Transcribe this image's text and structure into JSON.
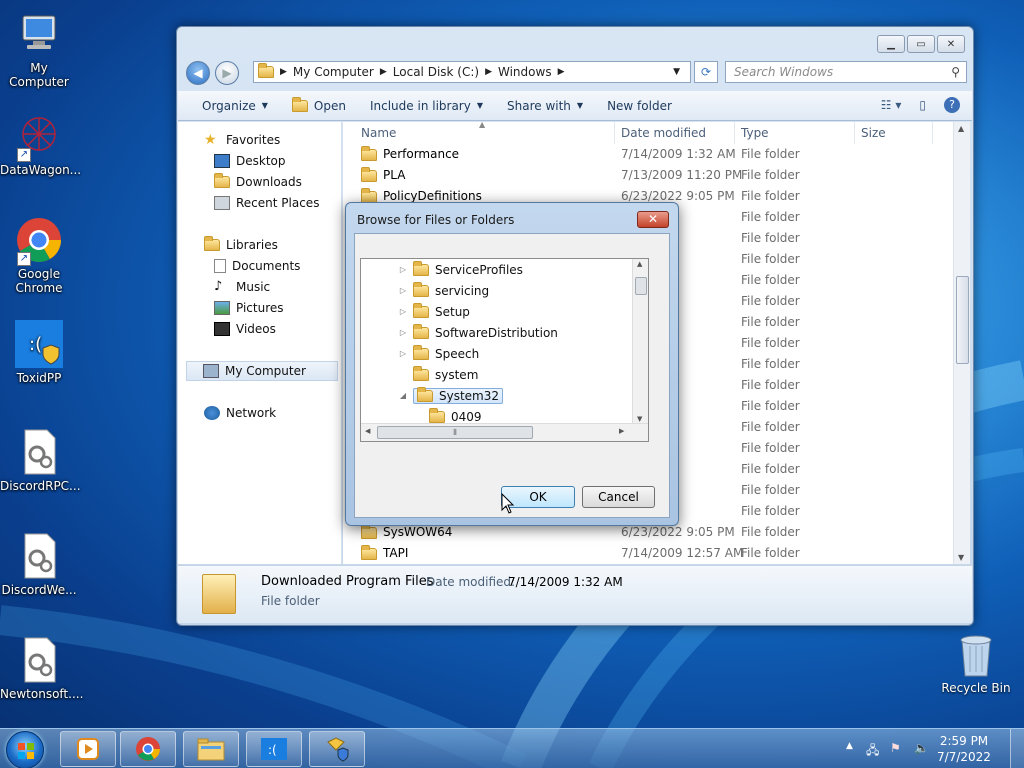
{
  "desktop": {
    "icons": [
      {
        "label": "My Computer"
      },
      {
        "label": "DataWagon..."
      },
      {
        "label": "Google Chrome"
      },
      {
        "label": "ToxidPP"
      },
      {
        "label": "DiscordRPC..."
      },
      {
        "label": "DiscordWe..."
      },
      {
        "label": "Newtonsoft...."
      }
    ],
    "recycle_bin": "Recycle Bin"
  },
  "explorer": {
    "breadcrumb": [
      "My Computer",
      "Local Disk (C:)",
      "Windows"
    ],
    "search_placeholder": "Search Windows",
    "toolbar": {
      "organize": "Organize",
      "open": "Open",
      "include_in_library": "Include in library",
      "share_with": "Share with",
      "new_folder": "New folder"
    },
    "nav": {
      "favorites": "Favorites",
      "desktop": "Desktop",
      "downloads": "Downloads",
      "recent_places": "Recent Places",
      "libraries": "Libraries",
      "documents": "Documents",
      "music": "Music",
      "pictures": "Pictures",
      "videos": "Videos",
      "my_computer": "My Computer",
      "network": "Network"
    },
    "columns": {
      "name": "Name",
      "date": "Date modified",
      "type": "Type",
      "size": "Size"
    },
    "rows": [
      {
        "name": "Performance",
        "date": "7/14/2009 1:32 AM",
        "type": "File folder"
      },
      {
        "name": "PLA",
        "date": "7/13/2009 11:20 PM",
        "type": "File folder"
      },
      {
        "name": "PolicyDefinitions",
        "date": "6/23/2022 9:05 PM",
        "type": "File folder"
      },
      {
        "name": "",
        "date": "9:23 PM",
        "type": "File folder"
      },
      {
        "name": "",
        "date": "1:20 PM",
        "type": "File folder"
      },
      {
        "name": "",
        "date": ":28 AM",
        "type": "File folder"
      },
      {
        "name": "",
        "date": "2:04 AM",
        "type": "File folder"
      },
      {
        "name": "",
        "date": ":32 AM",
        "type": "File folder"
      },
      {
        "name": "",
        "date": "10:35 PM",
        "type": "File folder"
      },
      {
        "name": "",
        "date": ":32 AM",
        "type": "File folder"
      },
      {
        "name": "",
        "date": ":28 AM",
        "type": "File folder"
      },
      {
        "name": "",
        "date": "2:45 AM",
        "type": "File folder"
      },
      {
        "name": "",
        "date": ":17 AM",
        "type": "File folder"
      },
      {
        "name": "",
        "date": "2:05 AM",
        "type": "File folder"
      },
      {
        "name": "",
        "date": ":42 PM",
        "type": "File folder"
      },
      {
        "name": "",
        "date": ":17 AM",
        "type": "File folder"
      },
      {
        "name": "",
        "date": "10:36 PM",
        "type": "File folder"
      },
      {
        "name": "",
        "date": ":43 PM",
        "type": "File folder"
      },
      {
        "name": "SysWOW64",
        "date": "6/23/2022 9:05 PM",
        "type": "File folder"
      },
      {
        "name": "TAPI",
        "date": "7/14/2009 12:57 AM",
        "type": "File folder"
      }
    ],
    "details": {
      "name": "Downloaded Program Files",
      "date_label": "Date modified:",
      "date_value": "7/14/2009 1:32 AM",
      "type": "File folder"
    }
  },
  "dialog": {
    "title": "Browse for Files or Folders",
    "close": "✕",
    "tree": [
      {
        "label": "ServiceProfiles",
        "expander": "▷"
      },
      {
        "label": "servicing",
        "expander": "▷"
      },
      {
        "label": "Setup",
        "expander": "▷"
      },
      {
        "label": "SoftwareDistribution",
        "expander": "▷"
      },
      {
        "label": "Speech",
        "expander": "▷"
      },
      {
        "label": "system",
        "expander": ""
      },
      {
        "label": "System32",
        "expander": "◢"
      },
      {
        "label": "0409",
        "expander": ""
      }
    ],
    "ok": "OK",
    "cancel": "Cancel"
  },
  "taskbar": {
    "time": "2:59 PM",
    "date": "7/7/2022"
  },
  "colors": {
    "accent": "#2d8fdc",
    "window_frame": "#c4d6ea",
    "selection": "#d3e6fb"
  }
}
